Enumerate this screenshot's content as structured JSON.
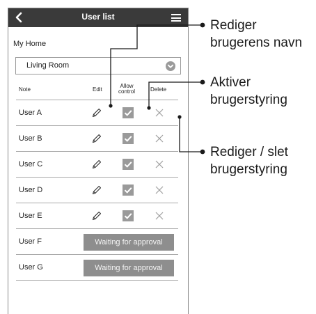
{
  "header": {
    "title": "User list",
    "back_icon": "chevron-left-icon",
    "menu_icon": "hamburger-menu-icon"
  },
  "home_name": "My Home",
  "room_select": {
    "value": "Living Room",
    "icon": "chevron-down-circle-icon"
  },
  "columns": {
    "note": "Note",
    "edit": "Edit",
    "allow_control_line1": "Allow",
    "allow_control_line2": "control",
    "delete": "Delete"
  },
  "users": [
    {
      "name": "User A",
      "status": "approved",
      "allow_control": true
    },
    {
      "name": "User B",
      "status": "approved",
      "allow_control": true
    },
    {
      "name": "User C",
      "status": "approved",
      "allow_control": true
    },
    {
      "name": "User D",
      "status": "approved",
      "allow_control": true
    },
    {
      "name": "User E",
      "status": "approved",
      "allow_control": true
    },
    {
      "name": "User F",
      "status": "waiting",
      "waiting_label": "Waiting for approval"
    },
    {
      "name": "User G",
      "status": "waiting",
      "waiting_label": "Waiting for approval"
    }
  ],
  "callouts": [
    {
      "line1": "Rediger",
      "line2": "brugerens navn"
    },
    {
      "line1": "Aktiver",
      "line2": "brugerstyring"
    },
    {
      "line1": "Rediger / slet",
      "line2": "brugerstyring"
    }
  ],
  "colors": {
    "titlebar": "#3a3a3a",
    "checkbox": "#9a9a9a",
    "waiting_button": "#8e8e8e",
    "divider": "#a8a8a8"
  }
}
